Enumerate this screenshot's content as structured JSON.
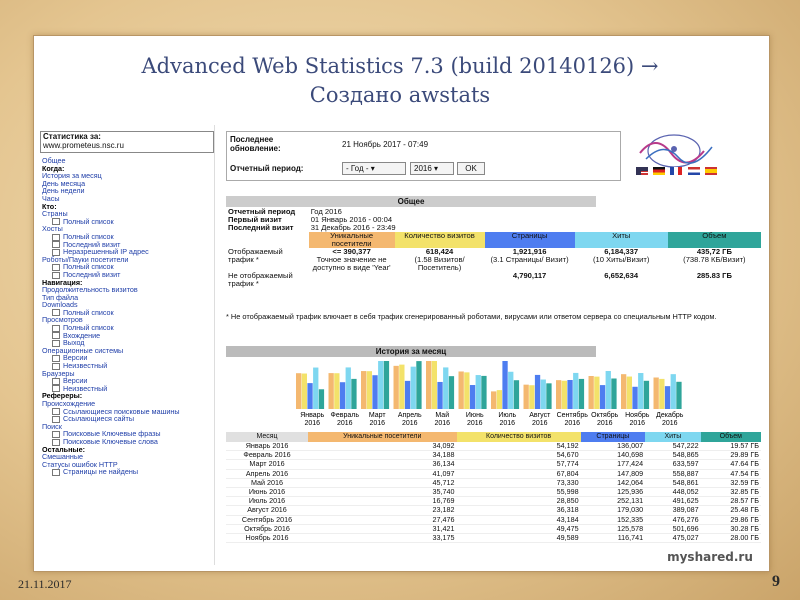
{
  "slide": {
    "title_line1": "Advanced Web Statistics 7.3 (build 20140126) →",
    "title_line2": "Создано awstats",
    "date": "21.11.2017",
    "page_number": "9"
  },
  "sidebar": {
    "stats_for_label": "Статистика за:",
    "site": "www.prometeus.nsc.ru",
    "items": [
      {
        "t": "Общее",
        "k": "lnk"
      },
      {
        "t": "Когда:",
        "k": "hdr"
      },
      {
        "t": "История за месяц",
        "k": "lnk"
      },
      {
        "t": "День месяца",
        "k": "lnk"
      },
      {
        "t": "День недели",
        "k": "lnk"
      },
      {
        "t": "Часы",
        "k": "lnk"
      },
      {
        "t": "Кто:",
        "k": "hdr"
      },
      {
        "t": "Страны",
        "k": "lnk"
      },
      {
        "t": "Полный список",
        "k": "sub"
      },
      {
        "t": "Хосты",
        "k": "lnk"
      },
      {
        "t": "Полный список",
        "k": "sub"
      },
      {
        "t": "Последний визит",
        "k": "sub"
      },
      {
        "t": "Неразрешенный IP адрес",
        "k": "sub"
      },
      {
        "t": "Роботы/Пауки посетители",
        "k": "lnk"
      },
      {
        "t": "Полный список",
        "k": "sub"
      },
      {
        "t": "Последний визит",
        "k": "sub"
      },
      {
        "t": "Навигация:",
        "k": "hdr"
      },
      {
        "t": "Продолжительность визитов",
        "k": "lnk"
      },
      {
        "t": "Тип файла",
        "k": "lnk"
      },
      {
        "t": "Downloads",
        "k": "lnk"
      },
      {
        "t": "Полный список",
        "k": "sub"
      },
      {
        "t": "Просмотров",
        "k": "lnk"
      },
      {
        "t": "Полный список",
        "k": "sub"
      },
      {
        "t": "Вхождение",
        "k": "sub"
      },
      {
        "t": "Выход",
        "k": "sub"
      },
      {
        "t": "Операционные системы",
        "k": "lnk"
      },
      {
        "t": "Версии",
        "k": "sub"
      },
      {
        "t": "Неизвестный",
        "k": "sub"
      },
      {
        "t": "Браузеры",
        "k": "lnk"
      },
      {
        "t": "Версии",
        "k": "sub"
      },
      {
        "t": "Неизвестный",
        "k": "sub"
      },
      {
        "t": "Рефереры:",
        "k": "hdr"
      },
      {
        "t": "Происхождение",
        "k": "lnk"
      },
      {
        "t": "Ссылающиеся поисковые машины",
        "k": "sub"
      },
      {
        "t": "Ссылающиеся сайты",
        "k": "sub"
      },
      {
        "t": "Поиск",
        "k": "lnk"
      },
      {
        "t": "Поисковые Ключевые фразы",
        "k": "sub"
      },
      {
        "t": "Поисковые Ключевые слова",
        "k": "sub"
      },
      {
        "t": "Остальные:",
        "k": "hdr"
      },
      {
        "t": "Смешанные",
        "k": "lnk"
      },
      {
        "t": "Статусы ошибок HTTP",
        "k": "lnk"
      },
      {
        "t": "Страницы не найдены",
        "k": "sub"
      }
    ]
  },
  "header": {
    "last_update_label": "Последнее обновление:",
    "last_update_value": "21 Ноябрь 2017 - 07:49",
    "period_label": "Отчетный период:",
    "period_month": "- Год -",
    "period_year": "2016",
    "ok_label": "OK"
  },
  "general": {
    "title": "Общее",
    "rows": [
      {
        "label": "Отчетный период",
        "value": "Год 2016"
      },
      {
        "label": "Первый визит",
        "value": "01 Январь 2016 - 00:04"
      },
      {
        "label": "Последний визит",
        "value": "31 Декабрь 2016 - 23:49"
      }
    ],
    "cols": [
      "Уникальные посетители",
      "Количество визитов",
      "Страницы",
      "Хиты",
      "Объем"
    ],
    "colors": [
      "#f4b870",
      "#f3e26a",
      "#4e7df0",
      "#7ed7f0",
      "#2fa59a"
    ],
    "shown_label": "Отображаемый трафик *",
    "shown": [
      "<= 390,377",
      "618,424",
      "1,921,916",
      "6,184,337",
      "435,72 ГБ"
    ],
    "shown_sub": [
      "Точное значение не доступно в виде 'Year'",
      "(1.58 Визитов/ Посетитель)",
      "(3.1 Страницы/ Визит)",
      "(10 Хиты/Визит)",
      "(738.78 КБ/Визит)"
    ],
    "hidden_label": "Не отображаемый трафик *",
    "hidden": [
      "",
      "",
      "4,790,117",
      "6,652,634",
      "285.83 ГБ"
    ],
    "note": "* Не отображаемый трафик влючает в себя трафик сгенерированный роботами, вирусами или ответом сервера со специальным HTTP кодом."
  },
  "history": {
    "title": "История за месяц",
    "month_col": "Месяц",
    "months_short": [
      "Январь",
      "Февраль",
      "Март",
      "Апрель",
      "Май",
      "Июнь",
      "Июль",
      "Август",
      "Сентябрь",
      "Октябрь",
      "Ноябрь",
      "Декабрь"
    ],
    "year": "2016",
    "rows": [
      [
        "Январь 2016",
        "34,092",
        "54,192",
        "136,007",
        "547,222",
        "19.57 ГБ"
      ],
      [
        "Февраль 2016",
        "34,188",
        "54,670",
        "140,698",
        "548,865",
        "29.89 ГБ"
      ],
      [
        "Март 2016",
        "36,134",
        "57,774",
        "177,424",
        "633,597",
        "47.64 ГБ"
      ],
      [
        "Апрель 2016",
        "41,097",
        "67,804",
        "147,809",
        "558,887",
        "47.54 ГБ"
      ],
      [
        "Май 2016",
        "45,712",
        "73,330",
        "142,064",
        "548,861",
        "32.59 ГБ"
      ],
      [
        "Июнь 2016",
        "35,740",
        "55,998",
        "125,936",
        "448,052",
        "32.85 ГБ"
      ],
      [
        "Июль 2016",
        "16,769",
        "28,850",
        "252,131",
        "491,625",
        "28.57 ГБ"
      ],
      [
        "Август 2016",
        "23,182",
        "36,318",
        "179,030",
        "389,087",
        "25.48 ГБ"
      ],
      [
        "Сентябрь 2016",
        "27,476",
        "43,184",
        "152,335",
        "476,276",
        "29.86 ГБ"
      ],
      [
        "Октябрь 2016",
        "31,421",
        "49,475",
        "125,578",
        "501,696",
        "30.28 ГБ"
      ],
      [
        "Ноябрь 2016",
        "33,175",
        "49,589",
        "116,741",
        "475,027",
        "28.00 ГБ"
      ]
    ]
  },
  "chart_data": {
    "type": "bar",
    "categories": [
      "Январь 2016",
      "Февраль 2016",
      "Март 2016",
      "Апрель 2016",
      "Май 2016",
      "Июнь 2016",
      "Июль 2016",
      "Август 2016",
      "Сентябрь 2016",
      "Октябрь 2016",
      "Ноябрь 2016",
      "Декабрь 2016"
    ],
    "series": [
      {
        "name": "Уникальные посетители",
        "color": "#f4b870",
        "values": [
          34092,
          34188,
          36134,
          41097,
          45712,
          35740,
          16769,
          23182,
          27476,
          31421,
          33175,
          30000
        ]
      },
      {
        "name": "Количество визитов",
        "color": "#f3e26a",
        "values": [
          54192,
          54670,
          57774,
          67804,
          73330,
          55998,
          28850,
          36318,
          43184,
          49475,
          49589,
          46000
        ]
      },
      {
        "name": "Страницы",
        "color": "#4e7df0",
        "values": [
          136007,
          140698,
          177424,
          147809,
          142064,
          125936,
          252131,
          179030,
          152335,
          125578,
          116741,
          120000
        ]
      },
      {
        "name": "Хиты",
        "color": "#7ed7f0",
        "values": [
          547222,
          548865,
          633597,
          558887,
          548861,
          448052,
          491625,
          389087,
          476276,
          501696,
          475027,
          460000
        ]
      },
      {
        "name": "Объем",
        "color": "#2fa59a",
        "values": [
          19.57,
          29.89,
          47.64,
          47.54,
          32.59,
          32.85,
          28.57,
          25.48,
          29.86,
          30.28,
          28.0,
          27.0
        ]
      }
    ]
  }
}
